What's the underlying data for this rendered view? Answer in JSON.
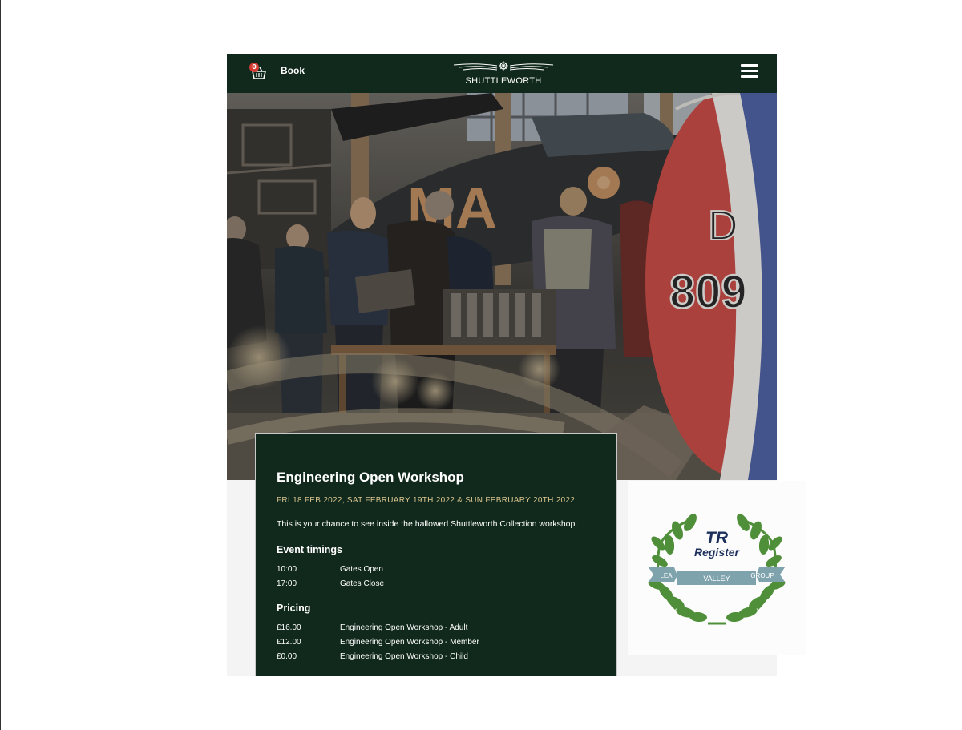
{
  "header": {
    "basket_count": "0",
    "book_label": "Book",
    "logo_text": "SHUTTLEWORTH"
  },
  "hero": {
    "roundel_letter": "D",
    "roundel_number": "809",
    "fuselage_letters": "MA"
  },
  "event": {
    "title": "Engineering Open Workshop",
    "dates": "FRI 18 FEB 2022, SAT FEBRUARY 19TH 2022 & SUN FEBRUARY 20TH 2022",
    "description": "This is your chance to see inside the hallowed Shuttleworth Collection workshop.",
    "timings_heading": "Event timings",
    "timings": [
      {
        "time": "10:00",
        "label": "Gates Open"
      },
      {
        "time": "17:00",
        "label": "Gates Close"
      }
    ],
    "pricing_heading": "Pricing",
    "pricing": [
      {
        "price": "£16.00",
        "label": "Engineering Open Workshop - Adult"
      },
      {
        "price": "£12.00",
        "label": "Engineering Open Workshop - Member"
      },
      {
        "price": "£0.00",
        "label": "Engineering Open Workshop - Child"
      }
    ]
  },
  "sponsor": {
    "line1": "TR",
    "line2": "Register",
    "ribbon_left": "LEA",
    "ribbon_mid": "VALLEY",
    "ribbon_right": "GROUP"
  },
  "colors": {
    "header_bg": "#11291c",
    "card_bg": "#11291c",
    "date_gold": "#d9c58e",
    "badge_red": "#d33a32",
    "laurel_green": "#4f8f3a",
    "ribbon_blue": "#7fa3ad",
    "tr_navy": "#1d2f5c"
  },
  "icons": [
    "basket-icon",
    "shuttleworth-logo",
    "hamburger-menu-icon",
    "laurel-wreath-icon"
  ]
}
